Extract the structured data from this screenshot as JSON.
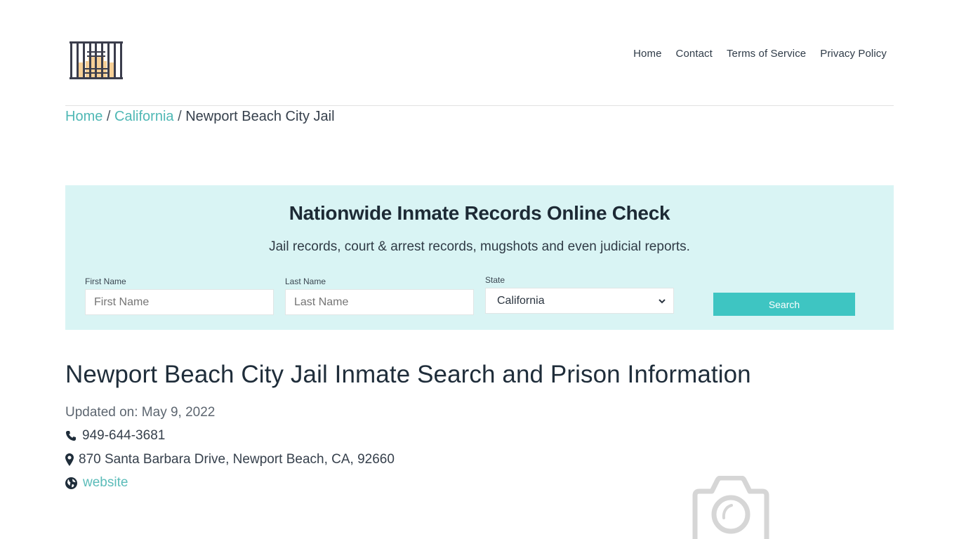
{
  "header": {
    "logo_icon": "jail-bars-logo-icon",
    "nav": [
      {
        "label": "Home"
      },
      {
        "label": "Contact"
      },
      {
        "label": "Terms of Service"
      },
      {
        "label": "Privacy Policy"
      }
    ]
  },
  "breadcrumb": {
    "items": [
      {
        "label": "Home",
        "link": true
      },
      {
        "label": "California",
        "link": true
      },
      {
        "label": "Newport Beach City Jail",
        "link": false
      }
    ],
    "separator": "/"
  },
  "search_panel": {
    "title": "Nationwide Inmate Records Online Check",
    "subtitle": "Jail records, court & arrest records, mugshots and even judicial reports.",
    "first_name": {
      "label": "First Name",
      "placeholder": "First Name",
      "value": ""
    },
    "last_name": {
      "label": "Last Name",
      "placeholder": "Last Name",
      "value": ""
    },
    "state": {
      "label": "State",
      "selected": "California"
    },
    "search_button": "Search",
    "colors": {
      "background": "#d9f4f4",
      "button": "#3ec5c2"
    }
  },
  "main": {
    "title": "Newport Beach City Jail Inmate Search and Prison Information",
    "updated": "Updated on: May 9, 2022",
    "phone": "949-644-3681",
    "address": "870 Santa Barbara Drive, Newport Beach, CA, 92660",
    "website_label": "website",
    "image_placeholder_icon": "camera-icon"
  },
  "colors": {
    "accent_link": "#4fb8b5",
    "text": "#212c3a"
  }
}
